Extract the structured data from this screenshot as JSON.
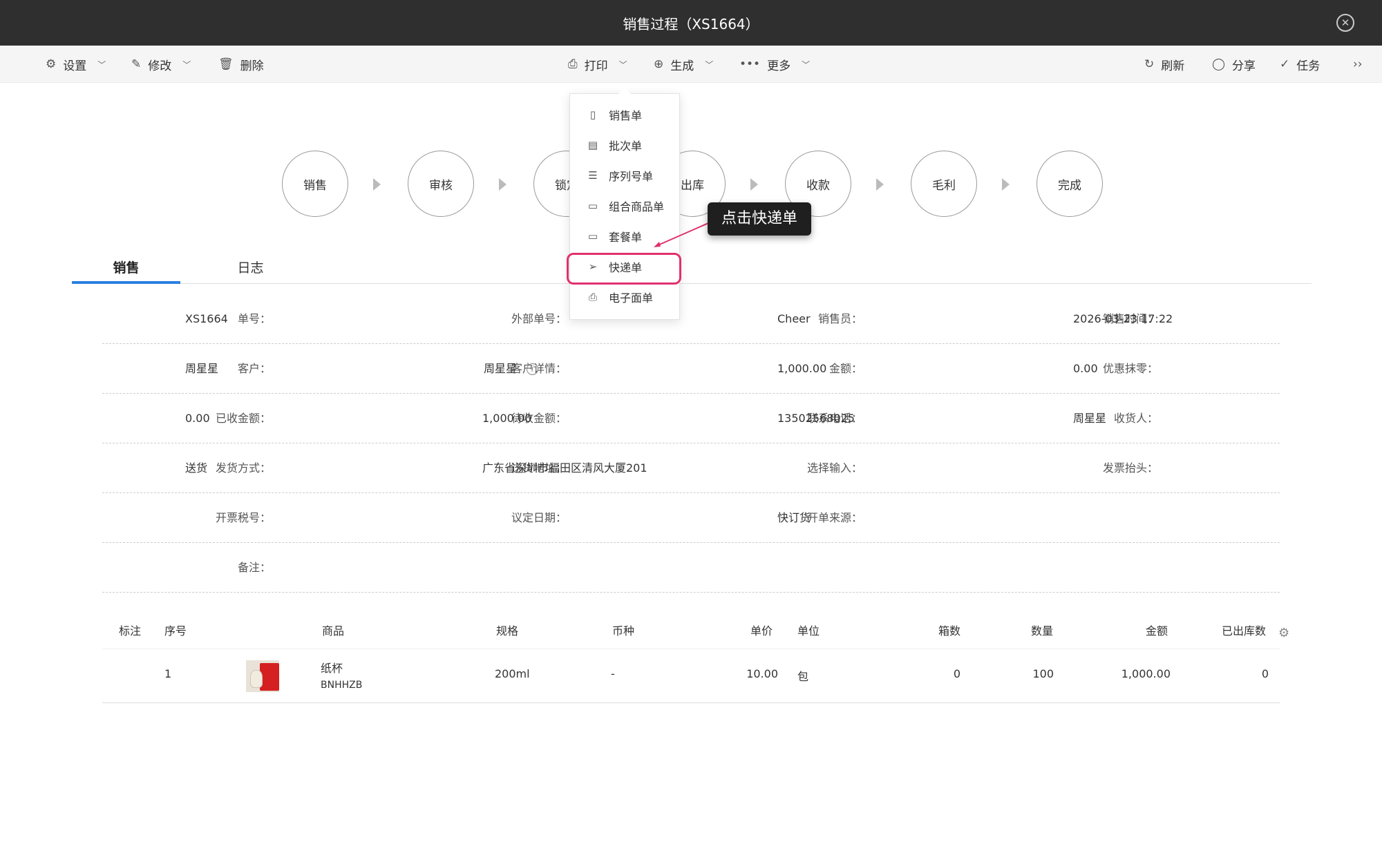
{
  "window": {
    "title": "销售过程（XS1664）"
  },
  "toolbar": {
    "settings": "设置",
    "edit": "修改",
    "delete": "删除",
    "print": "打印",
    "generate": "生成",
    "more": "更多",
    "refresh": "刷新",
    "share": "分享",
    "task": "任务",
    "expand": "››"
  },
  "flow": [
    "销售",
    "审核",
    "锁定",
    "出库",
    "收款",
    "毛利",
    "完成"
  ],
  "tabs": {
    "sales": "销售",
    "log": "日志"
  },
  "fields": [
    [
      {
        "label": "单号：",
        "value": "XS1664"
      },
      {
        "label": "外部单号：",
        "value": ""
      },
      {
        "label": "销售员：",
        "value": "Cheer"
      },
      {
        "label": "销售时间：",
        "value": "2026-03-23 17:22"
      }
    ],
    [
      {
        "label": "客户：",
        "value": "周星星"
      },
      {
        "label": "客户详情：",
        "value": "周星星"
      },
      {
        "label": "金额：",
        "value": "1,000.00"
      },
      {
        "label": "优惠抹零：",
        "value": "0.00"
      }
    ],
    [
      {
        "label": "已收金额：",
        "value": "0.00"
      },
      {
        "label": "待收金额：",
        "value": "1,000.00"
      },
      {
        "label": "联系电话：",
        "value": "13502568025"
      },
      {
        "label": "收货人：",
        "value": "周星星"
      }
    ],
    [
      {
        "label": "发货方式：",
        "value": "送货"
      },
      {
        "label": "送货地址：",
        "value": "广东省深圳市福田区清风大厦201"
      },
      {
        "label": "选择输入：",
        "value": ""
      },
      {
        "label": "发票抬头：",
        "value": ""
      }
    ],
    [
      {
        "label": "开票税号：",
        "value": ""
      },
      {
        "label": "议定日期：",
        "value": ""
      },
      {
        "label": "开单来源：",
        "value": "快订货"
      },
      {
        "label": "",
        "value": ""
      }
    ],
    [
      {
        "label": "备注：",
        "value": ""
      }
    ]
  ],
  "table": {
    "headers": [
      "标注",
      "序号",
      "商品",
      "规格",
      "币种",
      "单价",
      "单位",
      "箱数",
      "数量",
      "金额",
      "已出库数"
    ],
    "rows": [
      {
        "no": "1",
        "name": "纸杯",
        "code": "BNHHZB",
        "spec": "200ml",
        "currency": "-",
        "price": "10.00",
        "unit": "包",
        "boxes": "0",
        "qty": "100",
        "amount": "1,000.00",
        "shipped": "0"
      }
    ]
  },
  "print_menu": {
    "items": [
      "销售单",
      "批次单",
      "序列号单",
      "组合商品单",
      "套餐单",
      "快递单",
      "电子面单"
    ],
    "icons": [
      "doc-icon",
      "book-icon",
      "list-icon",
      "folder-icon",
      "folder-icon",
      "send-icon",
      "printer-icon"
    ]
  },
  "tooltip": "点击快递单",
  "colors": {
    "titlebar": "#2f2f2f",
    "tab_active": "#2a7fe0",
    "highlight": "#e0306e"
  }
}
